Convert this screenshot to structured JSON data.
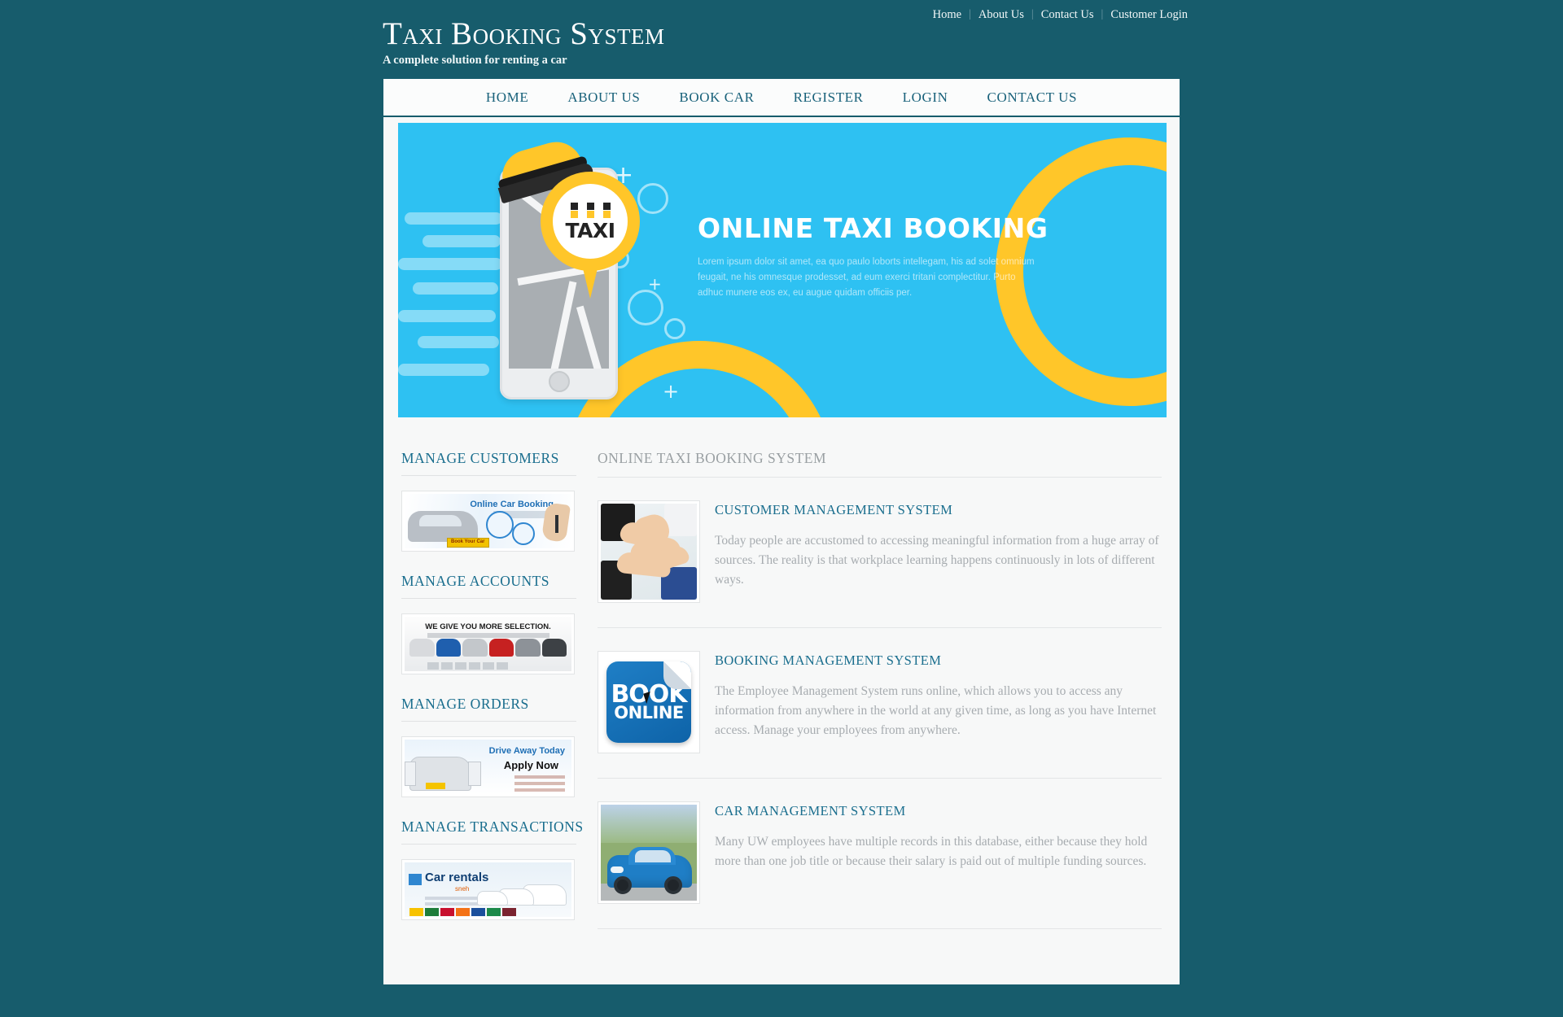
{
  "topnav": {
    "items": [
      {
        "label": "Home"
      },
      {
        "label": "About Us"
      },
      {
        "label": "Contact Us"
      },
      {
        "label": "Customer Login"
      }
    ],
    "separator": "|"
  },
  "brand": {
    "title": "Taxi Booking System",
    "tagline": "A complete solution for renting a car"
  },
  "mainnav": {
    "items": [
      {
        "label": "HOME"
      },
      {
        "label": "ABOUT US"
      },
      {
        "label": "BOOK CAR"
      },
      {
        "label": "REGISTER"
      },
      {
        "label": "LOGIN"
      },
      {
        "label": "CONTACT US"
      }
    ]
  },
  "hero": {
    "title": "ONLINE TAXI BOOKING",
    "text": "Lorem ipsum dolor sit amet, ea quo paulo loborts intellegam, his ad solet omnium feugait, ne his omnesque prodesset, ad eum exerci tritani complectitur. Purto adhuc munere eos ex, eu augue quidam officiis per.",
    "taxi_label": "TAXI",
    "colors": {
      "background": "#2ec1f2",
      "accent": "#ffc629"
    }
  },
  "sidebar": {
    "blocks": [
      {
        "heading": "MANAGE CUSTOMERS",
        "thumb_name": "online-car-booking-banner",
        "thumb_title": "Online Car Booking",
        "thumb_button": "Book Your Car"
      },
      {
        "heading": "MANAGE ACCOUNTS",
        "thumb_name": "more-selection-banner",
        "thumb_title": "WE GIVE YOU MORE SELECTION."
      },
      {
        "heading": "MANAGE ORDERS",
        "thumb_name": "drive-away-today-banner",
        "thumb_title": "Drive Away Today",
        "thumb_subtitle": "Apply Now"
      },
      {
        "heading": "MANAGE TRANSACTIONS",
        "thumb_name": "car-rentals-banner",
        "thumb_title": "Car rentals",
        "thumb_subtitle": "sneh"
      }
    ]
  },
  "main": {
    "heading": "ONLINE TAXI BOOKING SYSTEM",
    "articles": [
      {
        "title": "CUSTOMER MANAGEMENT SYSTEM",
        "text": "Today people are accustomed to accessing meaningful information from a huge array of sources. The reality is that workplace learning happens continuously in lots of different ways.",
        "image_name": "teamwork-hands-photo"
      },
      {
        "title": "BOOKING MANAGEMENT SYSTEM",
        "text": "The Employee Management System runs online, which allows you to access any information from anywhere in the world at any given time, as long as you have Internet access. Manage your employees from anywhere.",
        "image_name": "book-online-sticker",
        "image_text_line1": "BOOK",
        "image_text_line2": "ONLINE"
      },
      {
        "title": "CAR MANAGEMENT SYSTEM",
        "text": "Many UW employees have multiple records in this database, either because they hold more than one job title or because their salary is paid out of multiple funding sources.",
        "image_name": "blue-car-photo"
      }
    ]
  },
  "theme": {
    "page_background": "#175c6c",
    "panel_background": "#f7f8f8",
    "link_teal": "#1a6e8e",
    "muted_text": "#a7acb0"
  }
}
